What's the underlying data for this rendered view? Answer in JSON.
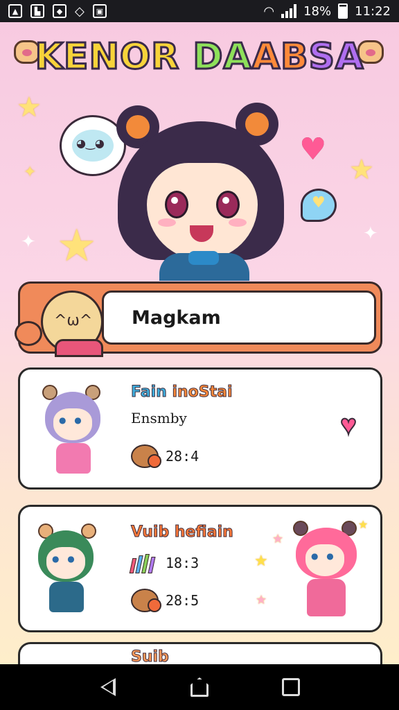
{
  "status_bar": {
    "battery_text": "18%",
    "time": "11:22",
    "icons": [
      "image-icon",
      "chart-icon",
      "app-icon",
      "wifi-cast-icon",
      "gallery-icon"
    ]
  },
  "header": {
    "title_parts": [
      "KENOR ",
      "DA",
      "AB",
      "SA"
    ]
  },
  "search": {
    "value": "Magkam"
  },
  "cards": [
    {
      "name_a": "Fain ",
      "name_b": "inoStai",
      "subtitle": "Ensmby",
      "stat": "28:4",
      "hair_color": "#a99ad8",
      "body_color": "#f27ab0"
    },
    {
      "name": "Vuib hefiain",
      "stat_books": "18:3",
      "stat_bear": "28:5",
      "hair_color": "#3a8a5a",
      "body_color": "#2c6a8a",
      "right_hair_color": "#ff6a9a",
      "right_body_color": "#f06a9a"
    },
    {
      "name": "Suib"
    }
  ],
  "colors": {
    "accent_orange": "#f08a5a",
    "heart_pink": "#ff5a95",
    "bg_top": "#f7c9e0",
    "bg_bottom": "#fff0c8"
  },
  "nav": {
    "buttons": [
      "back-icon",
      "home-icon",
      "recent-apps-icon"
    ]
  }
}
